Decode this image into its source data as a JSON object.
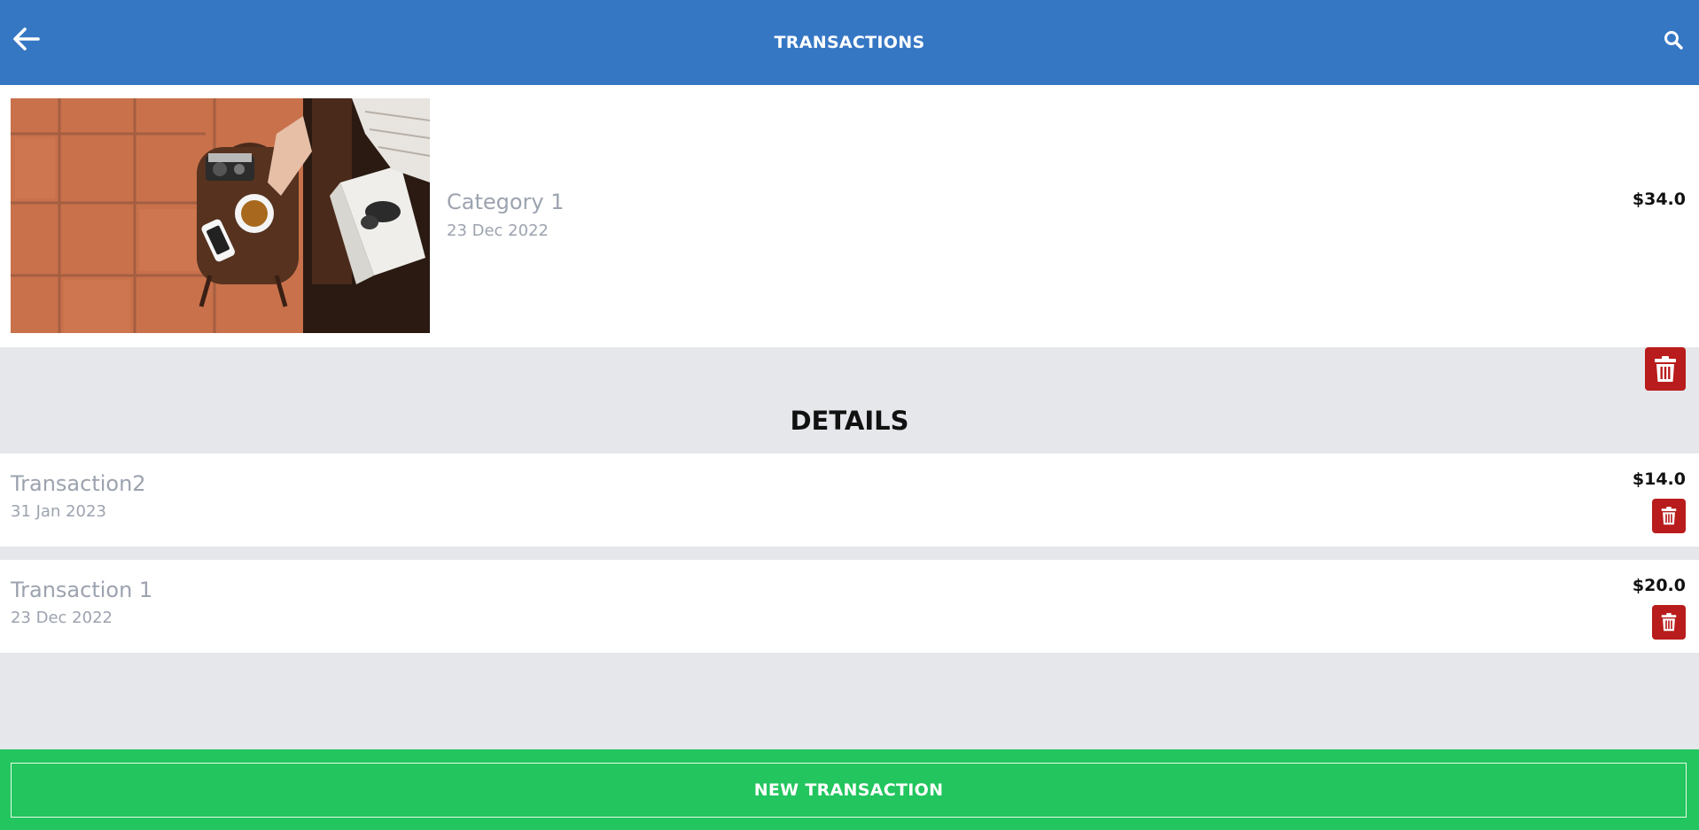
{
  "header": {
    "title": "TRANSACTIONS",
    "back_icon": "arrow-left-icon",
    "search_icon": "search-icon"
  },
  "category": {
    "name": "Category 1",
    "date": "23 Dec 2022",
    "amount": "$34.0",
    "image": "photo of a wooden stool with a cup of tea, camera, phone and magazine on a terracotta tile floor"
  },
  "details": {
    "heading": "DETAILS"
  },
  "transactions": [
    {
      "name": "Transaction2",
      "date": "31 Jan 2023",
      "amount": "$14.0"
    },
    {
      "name": "Transaction 1",
      "date": "23 Dec 2022",
      "amount": "$20.0"
    }
  ],
  "footer": {
    "new_transaction_label": "NEW TRANSACTION"
  },
  "colors": {
    "header": "#3677c4",
    "background": "#e5e7eb",
    "delete": "#b91c1c",
    "footer": "#22c55e",
    "muted_text": "#9ca3af"
  }
}
